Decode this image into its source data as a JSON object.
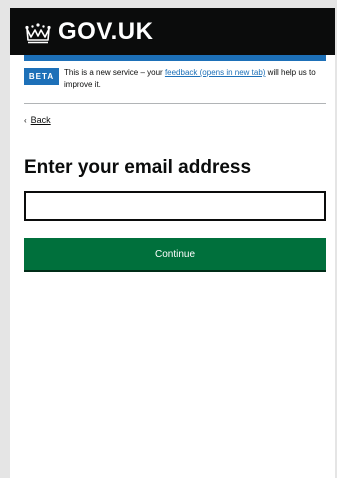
{
  "header": {
    "logo_text": "GOV.UK",
    "icon": "crown-icon",
    "background_color": "#0b0c0c",
    "accent_bar_color": "#1d70b8"
  },
  "phase_banner": {
    "tag": "BETA",
    "text_before": "This is a new service – your ",
    "feedback_link": "feedback (opens in new tab)",
    "text_after": " will help us to improve it."
  },
  "back_link": {
    "label": "Back",
    "icon": "chevron-left-icon"
  },
  "main": {
    "title": "Enter your email address",
    "email_input": {
      "value": "",
      "placeholder": ""
    },
    "continue_button": {
      "label": "Continue",
      "color": "#00703c"
    }
  }
}
